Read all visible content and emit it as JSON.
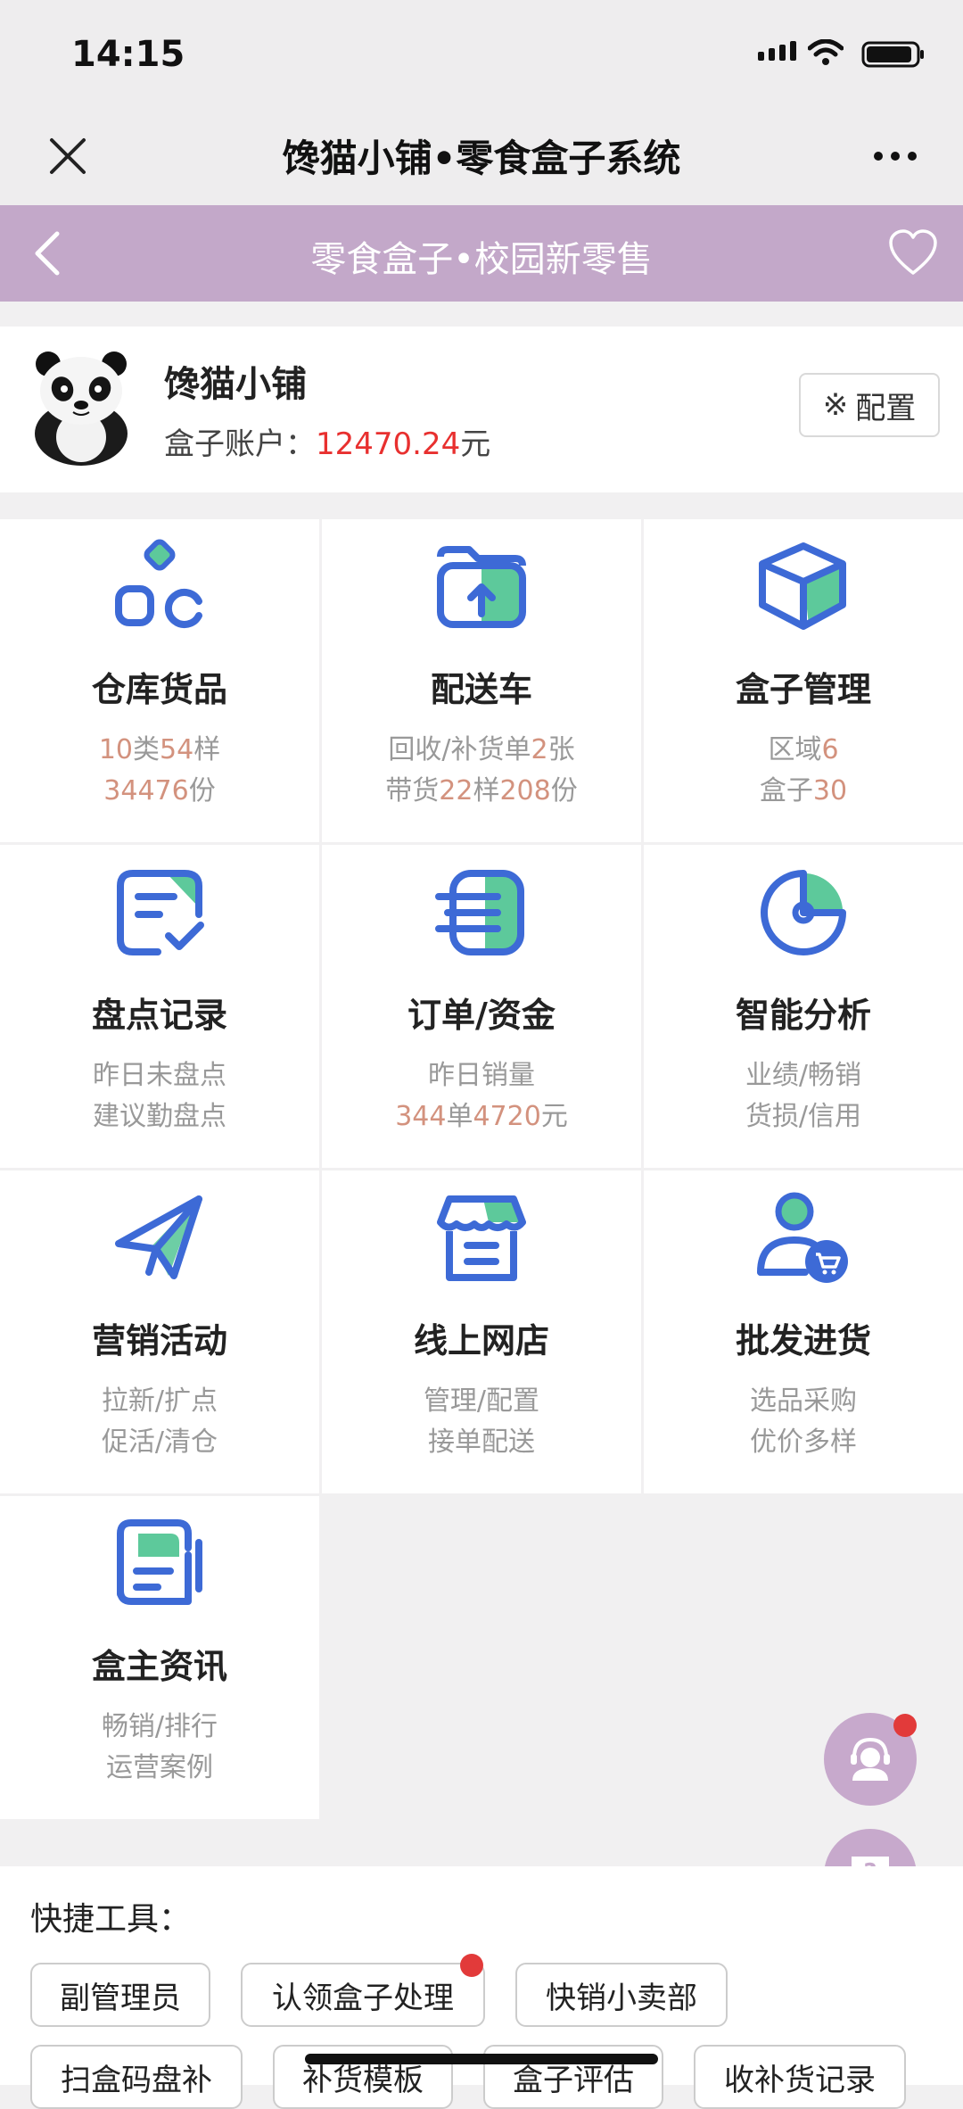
{
  "status_bar": {
    "time": "14:15"
  },
  "navbar": {
    "title": "馋猫小铺•零食盒子系统"
  },
  "banner": {
    "title": "零食盒子•校园新零售"
  },
  "profile": {
    "shop_name": "馋猫小铺",
    "account_label": "盒子账户：",
    "account_amount": "12470.24",
    "account_unit": "元",
    "config_label": "配置",
    "config_symbol": "※"
  },
  "grid": [
    {
      "label": "仓库货品",
      "icon": "warehouse-icon",
      "line1": [
        {
          "t": "10",
          "h": true
        },
        {
          "t": "类",
          "h": false
        },
        {
          "t": "54",
          "h": true
        },
        {
          "t": "样",
          "h": false
        }
      ],
      "line2": [
        {
          "t": "34476",
          "h": true
        },
        {
          "t": "份",
          "h": false
        }
      ]
    },
    {
      "label": "配送车",
      "icon": "delivery-folder-icon",
      "line1": [
        {
          "t": "回收/补货单",
          "h": false
        },
        {
          "t": "2",
          "h": true
        },
        {
          "t": "张",
          "h": false
        }
      ],
      "line2": [
        {
          "t": "带货",
          "h": false
        },
        {
          "t": "22",
          "h": true
        },
        {
          "t": "样",
          "h": false
        },
        {
          "t": "208",
          "h": true
        },
        {
          "t": "份",
          "h": false
        }
      ]
    },
    {
      "label": "盒子管理",
      "icon": "box-icon",
      "line1": [
        {
          "t": "区域",
          "h": false
        },
        {
          "t": "6",
          "h": true
        }
      ],
      "line2": [
        {
          "t": "盒子",
          "h": false
        },
        {
          "t": "30",
          "h": true
        }
      ]
    },
    {
      "label": "盘点记录",
      "icon": "inventory-check-icon",
      "line1": [
        {
          "t": "昨日未盘点",
          "h": false
        }
      ],
      "line2": [
        {
          "t": "建议勤盘点",
          "h": false
        }
      ]
    },
    {
      "label": "订单/资金",
      "icon": "order-list-icon",
      "line1": [
        {
          "t": "昨日销量",
          "h": false
        }
      ],
      "line2": [
        {
          "t": "344",
          "h": true
        },
        {
          "t": "单",
          "h": false
        },
        {
          "t": "4720",
          "h": true
        },
        {
          "t": "元",
          "h": false
        }
      ]
    },
    {
      "label": "智能分析",
      "icon": "pie-chart-icon",
      "line1": [
        {
          "t": "业绩/畅销",
          "h": false
        }
      ],
      "line2": [
        {
          "t": "货损/信用",
          "h": false
        }
      ]
    },
    {
      "label": "营销活动",
      "icon": "paper-plane-icon",
      "line1": [
        {
          "t": "拉新/扩点",
          "h": false
        }
      ],
      "line2": [
        {
          "t": "促活/清仓",
          "h": false
        }
      ]
    },
    {
      "label": "线上网店",
      "icon": "store-icon",
      "line1": [
        {
          "t": "管理/配置",
          "h": false
        }
      ],
      "line2": [
        {
          "t": "接单配送",
          "h": false
        }
      ]
    },
    {
      "label": "批发进货",
      "icon": "wholesale-user-cart-icon",
      "line1": [
        {
          "t": "选品采购",
          "h": false
        }
      ],
      "line2": [
        {
          "t": "优价多样",
          "h": false
        }
      ]
    },
    {
      "label": "盒主资讯",
      "icon": "news-icon",
      "line1": [
        {
          "t": "畅销/排行",
          "h": false
        }
      ],
      "line2": [
        {
          "t": "运营案例",
          "h": false
        }
      ]
    }
  ],
  "quick_tools": {
    "title": "快捷工具：",
    "row1": [
      "副管理员",
      "认领盒子处理",
      "快销小卖部"
    ],
    "row2": [
      "扫盒码盘补",
      "补货模板",
      "盒子评估",
      "收补货记录"
    ]
  },
  "colors": {
    "banner": "#c3a8c9",
    "icon_blue": "#3d6ad6",
    "icon_green": "#5dc99b",
    "highlight": "#d3927e",
    "amount_red": "#e8302f"
  }
}
